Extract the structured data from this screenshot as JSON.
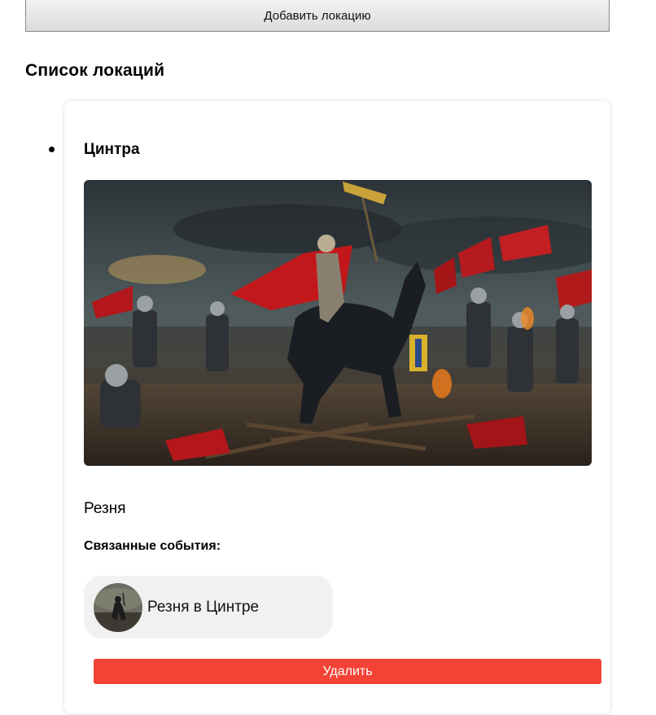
{
  "toolbar": {
    "add_location_label": "Добавить локацию"
  },
  "locations_section": {
    "title": "Список локаций"
  },
  "locations": [
    {
      "name": "Цинтра",
      "description": "Резня",
      "related_events_label": "Связанные события:",
      "related_events": [
        {
          "name": "Резня в Цинтре"
        }
      ],
      "delete_label": "Удалить"
    }
  ],
  "colors": {
    "delete_button": "#f44336",
    "event_chip_bg": "#f1f1f1"
  }
}
